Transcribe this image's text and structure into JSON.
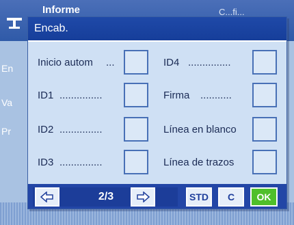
{
  "background": {
    "header_title": "Informe",
    "header_right": "C...fi...",
    "rows": [
      "En",
      "Va",
      "Pr"
    ]
  },
  "dialog": {
    "title": "Encab.",
    "items_left": [
      {
        "label": "Inicio autom",
        "dots": "...",
        "checked": false
      },
      {
        "label": "ID1",
        "dots": "...............",
        "checked": false
      },
      {
        "label": "ID2",
        "dots": "...............",
        "checked": false
      },
      {
        "label": "ID3",
        "dots": "...............",
        "checked": false
      }
    ],
    "items_right": [
      {
        "label": "ID4",
        "dots": "...............",
        "checked": false
      },
      {
        "label": "Firma",
        "dots": "...........",
        "checked": false
      },
      {
        "label": "Línea en blanco",
        "dots": "",
        "checked": false
      },
      {
        "label": "Línea de trazos",
        "dots": "",
        "checked": false
      }
    ],
    "footer": {
      "page_indicator": "2/3",
      "std_label": "STD",
      "c_label": "C",
      "ok_label": "OK"
    }
  },
  "colors": {
    "title_bar": "#1f49a8",
    "footer": "#2346a6",
    "ok": "#4fbf2a"
  }
}
